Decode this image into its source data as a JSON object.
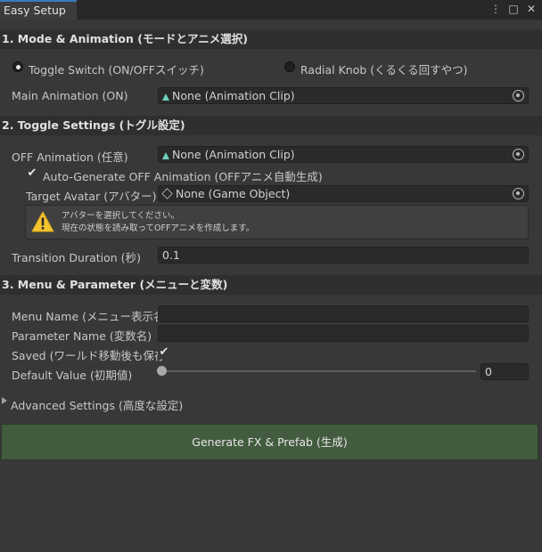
{
  "window": {
    "tab_title": "Easy Setup",
    "menu_icon": "⋮",
    "maximize_icon": "□",
    "close_icon": "✕"
  },
  "section1": {
    "title": "1. Mode & Animation (モードとアニメ選択)",
    "radio_toggle_label": "Toggle Switch (ON/OFFスイッチ)",
    "radio_radial_label": "Radial Knob (くるくる回すやつ)",
    "selected_mode": "Toggle Switch (ON/OFFスイッチ)",
    "main_anim_label": "Main Animation (ON)",
    "main_anim_value": "None (Animation Clip)"
  },
  "section2": {
    "title": "2. Toggle Settings (トグル設定)",
    "off_anim_label": "OFF Animation (任意)",
    "off_anim_value": "None (Animation Clip)",
    "auto_gen_checked": true,
    "auto_gen_label": "Auto-Generate OFF Animation (OFFアニメ自動生成)",
    "target_avatar_label": "Target Avatar (アバター)",
    "target_avatar_value": "None (Game Object)",
    "warning_line1": "アバターを選択してください。",
    "warning_line2": "現在の状態を読み取ってOFFアニメを作成します。",
    "transition_label": "Transition Duration (秒)",
    "transition_value": "0.1"
  },
  "section3": {
    "title": "3. Menu & Parameter (メニューと変数)",
    "menu_name_label": "Menu Name (メニュー表示名)",
    "menu_name_value": "",
    "param_name_label": "Parameter Name (変数名)",
    "param_name_value": "",
    "saved_label": "Saved (ワールド移動後も保存",
    "saved_checked": true,
    "default_value_label": "Default Value (初期値)",
    "default_value": "0",
    "slider_fraction": 0
  },
  "advanced": {
    "label": "Advanced Settings (高度な設定)",
    "expanded": false
  },
  "generate_button": "Generate FX & Prefab (生成)",
  "colors": {
    "accent_tab": "#3a79bb",
    "button_bg": "#435c3f",
    "warning_icon": "#f4c430"
  }
}
